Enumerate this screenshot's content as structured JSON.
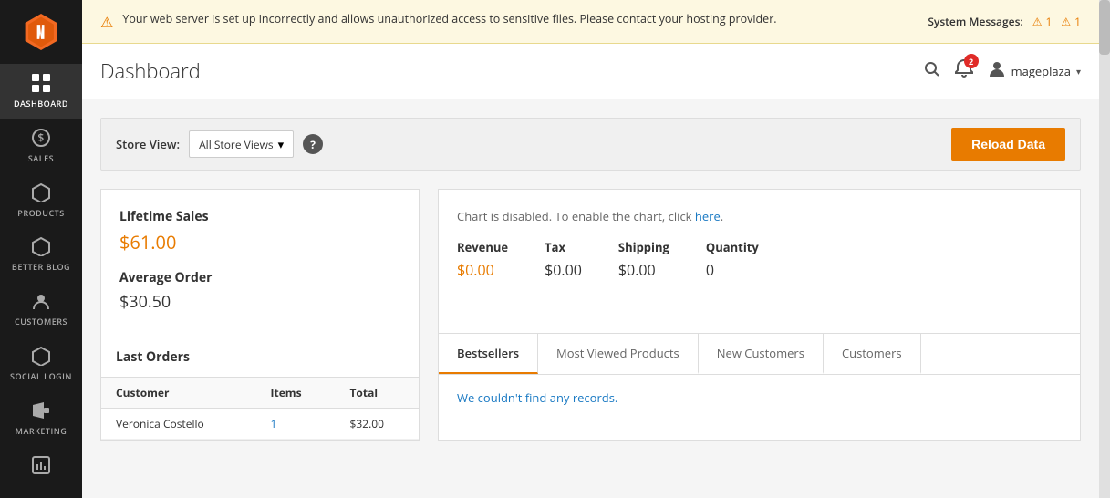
{
  "sidebar": {
    "logo_alt": "Magento",
    "items": [
      {
        "id": "dashboard",
        "label": "DASHBOARD",
        "icon": "⊞",
        "active": true
      },
      {
        "id": "sales",
        "label": "SALES",
        "icon": "$"
      },
      {
        "id": "products",
        "label": "PRODUCTS",
        "icon": "⬡"
      },
      {
        "id": "better-blog",
        "label": "BETTER BLOG",
        "icon": "⬡"
      },
      {
        "id": "customers",
        "label": "CUSTOMERS",
        "icon": "👤"
      },
      {
        "id": "social-login",
        "label": "SOCIAL LOGIN",
        "icon": "⬡"
      },
      {
        "id": "marketing",
        "label": "MARKETING",
        "icon": "📢"
      },
      {
        "id": "reports",
        "label": "",
        "icon": "⬜"
      }
    ]
  },
  "warning": {
    "message": "Your web server is set up incorrectly and allows unauthorized access to sensitive files. Please contact your hosting provider.",
    "system_messages_label": "System Messages:",
    "badge1": "1",
    "badge2": "1"
  },
  "header": {
    "title": "Dashboard",
    "notification_count": "2",
    "user_name": "mageplaza",
    "search_icon": "search",
    "bell_icon": "bell",
    "user_icon": "user",
    "chevron_icon": "▾"
  },
  "store_view": {
    "label": "Store View:",
    "value": "All Store Views",
    "help_text": "?",
    "reload_button": "Reload Data"
  },
  "lifetime_sales": {
    "label": "Lifetime Sales",
    "value": "$61.00"
  },
  "average_order": {
    "label": "Average Order",
    "value": "$30.50"
  },
  "chart": {
    "disabled_text": "Chart is disabled. To enable the chart, click",
    "link_text": "here",
    "link_href": "#"
  },
  "revenue": {
    "items": [
      {
        "label": "Revenue",
        "value": "$0.00",
        "orange": true
      },
      {
        "label": "Tax",
        "value": "$0.00",
        "orange": false
      },
      {
        "label": "Shipping",
        "value": "$0.00",
        "orange": false
      },
      {
        "label": "Quantity",
        "value": "0",
        "orange": false
      }
    ]
  },
  "last_orders": {
    "title": "Last Orders",
    "columns": [
      "Customer",
      "Items",
      "Total"
    ],
    "rows": [
      {
        "customer": "Veronica Costello",
        "items": "1",
        "total": "$32.00"
      }
    ]
  },
  "tabs": {
    "items": [
      {
        "id": "bestsellers",
        "label": "Bestsellers",
        "active": true
      },
      {
        "id": "most-viewed",
        "label": "Most Viewed Products",
        "active": false
      },
      {
        "id": "new-customers",
        "label": "New Customers",
        "active": false
      },
      {
        "id": "customers",
        "label": "Customers",
        "active": false
      }
    ],
    "empty_message": "We couldn't find any records."
  }
}
